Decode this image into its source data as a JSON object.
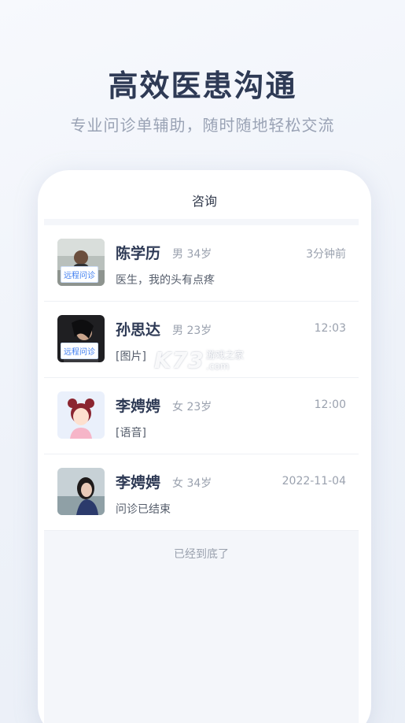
{
  "hero": {
    "title": "高效医患沟通",
    "subtitle": "专业问诊单辅助，随时随地轻松交流"
  },
  "screen": {
    "title": "咨询",
    "footer": "已经到底了"
  },
  "conversations": [
    {
      "name": "陈学历",
      "meta": "男 34岁",
      "time": "3分钟前",
      "message": "医生，我的头有点疼",
      "tag": "远程问诊"
    },
    {
      "name": "孙思达",
      "meta": "男 23岁",
      "time": "12:03",
      "message": "[图片]",
      "tag": "远程问诊"
    },
    {
      "name": "李娉娉",
      "meta": "女 23岁",
      "time": "12:00",
      "message": "[语音]",
      "tag": ""
    },
    {
      "name": "李娉娉",
      "meta": "女 34岁",
      "time": "2022-11-04",
      "message": "问诊已结束",
      "tag": ""
    }
  ],
  "watermark": {
    "logo": "K73",
    "line1": "游戏之家",
    "line2": ".com"
  },
  "colors": {
    "title": "#2e3a55",
    "tag": "#3b7cf0",
    "muted": "#9aa1ae"
  }
}
